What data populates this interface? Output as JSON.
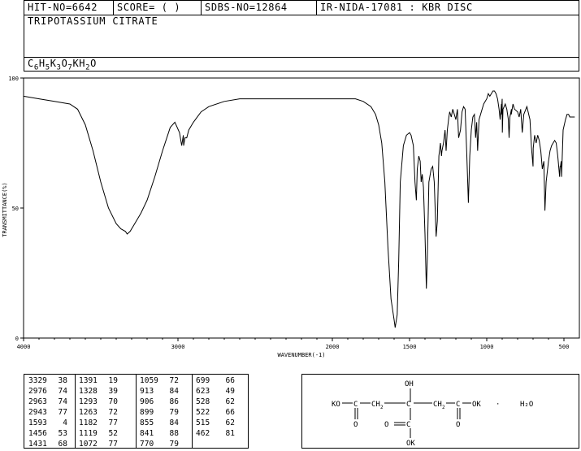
{
  "header": {
    "hit_no": "HIT-NO=6642",
    "score": "SCORE=  (   )",
    "sdbs_no": "SDBS-NO=12864",
    "ir_no": "IR-NIDA-17081 : KBR DISC"
  },
  "compound": {
    "name": "TRIPOTASSIUM CITRATE",
    "formula_parts": [
      "C",
      "6",
      "H",
      "5",
      "K",
      "3",
      "O",
      "7",
      "KH",
      "2",
      "O"
    ]
  },
  "chart_data": {
    "type": "line",
    "xlabel": "WAVENUMBER(-1)",
    "ylabel": "TRANSMITTANCE(%)",
    "xlim": [
      4000,
      400
    ],
    "ylim": [
      0,
      100
    ],
    "x_ticks": [
      4000,
      3000,
      2000,
      1500,
      1000,
      500
    ],
    "y_ticks": [
      0,
      50,
      100
    ],
    "grid": false,
    "x": [
      4000,
      3900,
      3800,
      3700,
      3650,
      3600,
      3550,
      3500,
      3450,
      3400,
      3370,
      3340,
      3329,
      3310,
      3280,
      3240,
      3200,
      3150,
      3100,
      3050,
      3020,
      2990,
      2976,
      2965,
      2963,
      2955,
      2943,
      2930,
      2900,
      2850,
      2800,
      2700,
      2600,
      2500,
      2400,
      2300,
      2200,
      2100,
      2000,
      1950,
      1900,
      1850,
      1800,
      1750,
      1720,
      1700,
      1680,
      1660,
      1640,
      1620,
      1600,
      1593,
      1580,
      1570,
      1560,
      1540,
      1520,
      1500,
      1490,
      1475,
      1465,
      1456,
      1450,
      1440,
      1431,
      1425,
      1418,
      1410,
      1400,
      1391,
      1385,
      1375,
      1360,
      1350,
      1340,
      1328,
      1320,
      1310,
      1300,
      1293,
      1290,
      1280,
      1270,
      1263,
      1255,
      1245,
      1240,
      1230,
      1220,
      1200,
      1190,
      1182,
      1170,
      1160,
      1150,
      1140,
      1130,
      1119,
      1110,
      1100,
      1090,
      1080,
      1072,
      1065,
      1059,
      1050,
      1040,
      1030,
      1020,
      1000,
      990,
      980,
      970,
      960,
      950,
      940,
      930,
      920,
      913,
      905,
      906,
      900,
      899,
      895,
      880,
      870,
      860,
      855,
      850,
      840,
      841,
      830,
      820,
      800,
      790,
      780,
      770,
      760,
      740,
      720,
      710,
      700,
      699,
      690,
      680,
      670,
      660,
      650,
      640,
      630,
      623,
      615,
      600,
      590,
      580,
      570,
      560,
      550,
      540,
      528,
      525,
      522,
      518,
      515,
      505,
      490,
      480,
      470,
      462,
      450,
      430,
      410
    ],
    "y": [
      93,
      92,
      91,
      90,
      88,
      82,
      72,
      60,
      50,
      44,
      42,
      41,
      40,
      41,
      44,
      48,
      53,
      62,
      72,
      81,
      83,
      79,
      74,
      78,
      74,
      77,
      77,
      80,
      83,
      87,
      89,
      91,
      92,
      92,
      92,
      92,
      92,
      92,
      92,
      92,
      92,
      92,
      91,
      89,
      86,
      82,
      75,
      60,
      35,
      15,
      7,
      4,
      9,
      30,
      60,
      74,
      78,
      79,
      78,
      74,
      60,
      53,
      65,
      70,
      68,
      60,
      63,
      58,
      40,
      19,
      30,
      60,
      65,
      66,
      60,
      39,
      45,
      70,
      75,
      70,
      72,
      75,
      80,
      72,
      80,
      85,
      87,
      85,
      88,
      84,
      88,
      77,
      80,
      87,
      89,
      88,
      72,
      52,
      70,
      80,
      85,
      86,
      77,
      83,
      72,
      84,
      86,
      88,
      90,
      92,
      94,
      93,
      94,
      95,
      95,
      94,
      92,
      88,
      84,
      90,
      86,
      92,
      79,
      88,
      90,
      88,
      84,
      77,
      85,
      88,
      86,
      90,
      88,
      87,
      85,
      88,
      79,
      86,
      89,
      84,
      73,
      66,
      73,
      78,
      75,
      78,
      76,
      72,
      65,
      68,
      49,
      60,
      68,
      72,
      74,
      75,
      76,
      75,
      70,
      62,
      66,
      66,
      68,
      62,
      80,
      84,
      86,
      86,
      85,
      85,
      85
    ]
  },
  "peaks": [
    {
      "cm": "3329",
      "t": "38"
    },
    {
      "cm": "2976",
      "t": "74"
    },
    {
      "cm": "2963",
      "t": "74"
    },
    {
      "cm": "2943",
      "t": "77"
    },
    {
      "cm": "1593",
      "t": "4"
    },
    {
      "cm": "1456",
      "t": "53"
    },
    {
      "cm": "1431",
      "t": "68"
    },
    {
      "cm": "1391",
      "t": "19"
    },
    {
      "cm": "1328",
      "t": "39"
    },
    {
      "cm": "1293",
      "t": "70"
    },
    {
      "cm": "1263",
      "t": "72"
    },
    {
      "cm": "1182",
      "t": "77"
    },
    {
      "cm": "1119",
      "t": "52"
    },
    {
      "cm": "1072",
      "t": "77"
    },
    {
      "cm": "1059",
      "t": "72"
    },
    {
      "cm": "913",
      "t": "84"
    },
    {
      "cm": "906",
      "t": "86"
    },
    {
      "cm": "899",
      "t": "79"
    },
    {
      "cm": "855",
      "t": "84"
    },
    {
      "cm": "841",
      "t": "88"
    },
    {
      "cm": "770",
      "t": "79"
    },
    {
      "cm": "699",
      "t": "66"
    },
    {
      "cm": "623",
      "t": "49"
    },
    {
      "cm": "528",
      "t": "62"
    },
    {
      "cm": "522",
      "t": "66"
    },
    {
      "cm": "515",
      "t": "62"
    },
    {
      "cm": "462",
      "t": "81"
    }
  ],
  "structure": {
    "oh": "OH",
    "left_group": "KO",
    "right_group": "OK",
    "bottom_group": "OK",
    "carbonyl_o": "O",
    "hydrate": "H₂O",
    "dot": "·"
  }
}
